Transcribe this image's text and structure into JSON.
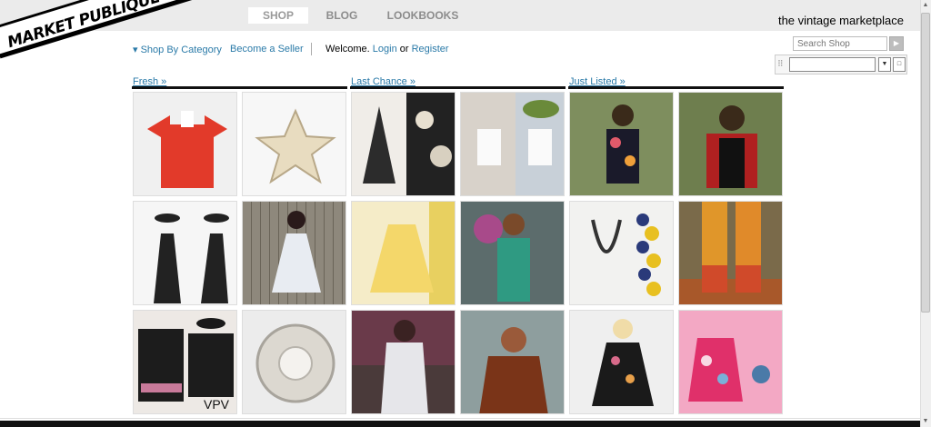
{
  "brand": {
    "logo_text": "MARKET PUBLIQUE",
    "tagline": "the vintage marketplace"
  },
  "nav": [
    {
      "label": "SHOP",
      "active": true
    },
    {
      "label": "BLOG",
      "active": false
    },
    {
      "label": "LOOKBOOKS",
      "active": false
    }
  ],
  "links": {
    "shop_by_category": "▾ Shop By Category",
    "become_seller": "Become a Seller",
    "welcome": "Welcome.",
    "login": "Login",
    "or": "or",
    "register": "Register"
  },
  "search": {
    "placeholder": "Search Shop"
  },
  "sections": [
    {
      "label": "Fresh »"
    },
    {
      "label": "Last Chance »"
    },
    {
      "label": "Just Listed »"
    }
  ],
  "tiles": [
    {
      "name": "red-tee",
      "bg": "#f0f0f0"
    },
    {
      "name": "star-brooch",
      "bg": "#f7f7f7"
    },
    {
      "name": "floral-dress",
      "bg": "#efece8"
    },
    {
      "name": "white-romper",
      "bg": "#d9d3cc"
    },
    {
      "name": "floral-outdoor",
      "bg": "#8a9a6a"
    },
    {
      "name": "plaid-outdoor",
      "bg": "#7a8a5a"
    },
    {
      "name": "black-maxi",
      "bg": "#f5f5f5"
    },
    {
      "name": "white-hilo",
      "bg": "#8a8478"
    },
    {
      "name": "yellow-dress",
      "bg": "#f3e8c8"
    },
    {
      "name": "green-dress",
      "bg": "#6a7a6a"
    },
    {
      "name": "bead-necklace",
      "bg": "#f0f0ee"
    },
    {
      "name": "orange-boots",
      "bg": "#7a6a4a"
    },
    {
      "name": "black-tunic",
      "bg": "#ece8e4",
      "caption": "VPV"
    },
    {
      "name": "rhinestone-brooch",
      "bg": "#ededed"
    },
    {
      "name": "white-lace",
      "bg": "#5a4a4a"
    },
    {
      "name": "brown-leather",
      "bg": "#8a9a9a"
    },
    {
      "name": "floral-black",
      "bg": "#eeeeee"
    },
    {
      "name": "pink-floral",
      "bg": "#f2a6c2"
    }
  ],
  "colors": {
    "link": "#2a7aa8",
    "topbar": "#ebebeb"
  }
}
